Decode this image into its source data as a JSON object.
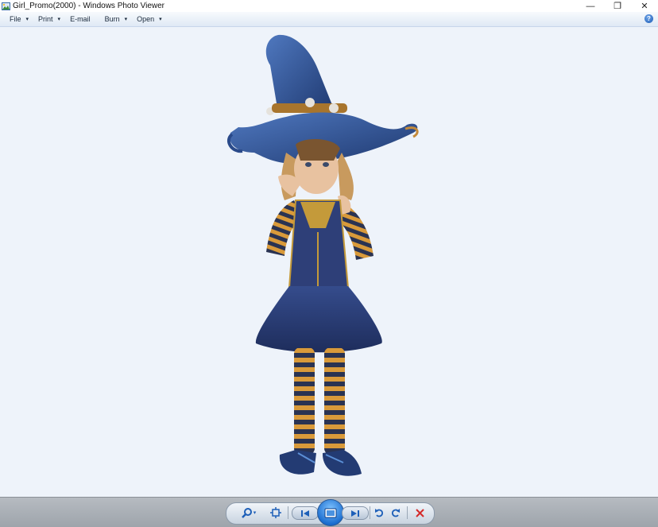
{
  "window": {
    "title": "Girl_Promo(2000) - Windows Photo Viewer",
    "controls": {
      "minimize": "—",
      "restore": "❐",
      "close": "✕"
    }
  },
  "menu": {
    "items": [
      {
        "label": "File",
        "has_dropdown": true
      },
      {
        "label": "Print",
        "has_dropdown": true
      },
      {
        "label": "E-mail",
        "has_dropdown": false
      },
      {
        "label": "Burn",
        "has_dropdown": true
      },
      {
        "label": "Open",
        "has_dropdown": true
      }
    ],
    "caret": "▾",
    "help": "?"
  },
  "photo": {
    "subject": "witch-girl-character",
    "colors": {
      "hat": "#2d4f8e",
      "dress": "#2b3f7a",
      "stripes_dark": "#2a3352",
      "stripes_light": "#d99a3a",
      "skin": "#e8c2a0",
      "hair": "#c89a5e"
    }
  },
  "toolbar": {
    "zoom_caret": "▾",
    "icons": [
      "zoom-icon",
      "actual-size-icon",
      "previous-icon",
      "slideshow-icon",
      "next-icon",
      "rotate-counterclockwise-icon",
      "rotate-clockwise-icon",
      "delete-icon"
    ],
    "accent": "#1d6fd0",
    "delete_color": "#d42a2a"
  }
}
